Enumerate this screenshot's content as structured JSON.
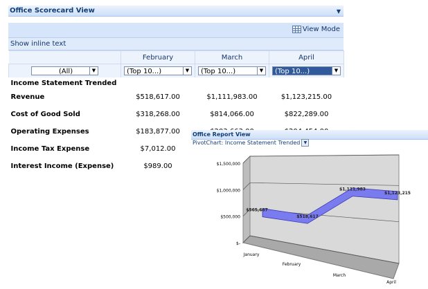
{
  "scorecard": {
    "title": "Office Scorecard View",
    "view_mode_label": "View Mode",
    "inline_text_label": "Show inline text",
    "columns": [
      "February",
      "March",
      "April"
    ],
    "filters": {
      "row_filter": "(All)",
      "column_filters": [
        "(Top 10...)",
        "(Top 10...)",
        "(Top 10...)"
      ]
    },
    "section_label": "Income Statement Trended",
    "rows": [
      {
        "label": "Revenue",
        "values": [
          "$518,617.00",
          "$1,111,983.00",
          "$1,123,215.00"
        ]
      },
      {
        "label": "Cost of Good Sold",
        "values": [
          "$318,268.00",
          "$814,066.00",
          "$822,289.00"
        ]
      },
      {
        "label": "Operating Expenses",
        "values": [
          "$183,877.00",
          "$203,663.00",
          "$204,454.00"
        ]
      },
      {
        "label": "Income Tax Expense",
        "values": [
          "$7,012.00",
          "",
          ""
        ]
      },
      {
        "label": "Interest Income (Expense)",
        "values": [
          "$989.00",
          "",
          ""
        ]
      }
    ],
    "colors": {
      "title_text": "#123e76",
      "selected_filter": "#315a9c"
    }
  },
  "report": {
    "title": "Office Report View",
    "subtitle": "PivotChart: Income Statement Trended",
    "chart_data": {
      "type": "area",
      "categories": [
        "January",
        "February",
        "March",
        "April"
      ],
      "series": [
        {
          "name": "",
          "values": [
            565667,
            518617,
            1111983,
            1123215
          ],
          "labels": [
            "$565,667",
            "$518,617",
            "$1,111,983",
            "$1,123,215"
          ]
        }
      ],
      "yticks": [
        "$1,500,000",
        "$1,000,000",
        "$500,000",
        "$-"
      ],
      "ylim": [
        0,
        1500000
      ],
      "grid": true,
      "color": "#7b7bf0"
    }
  }
}
